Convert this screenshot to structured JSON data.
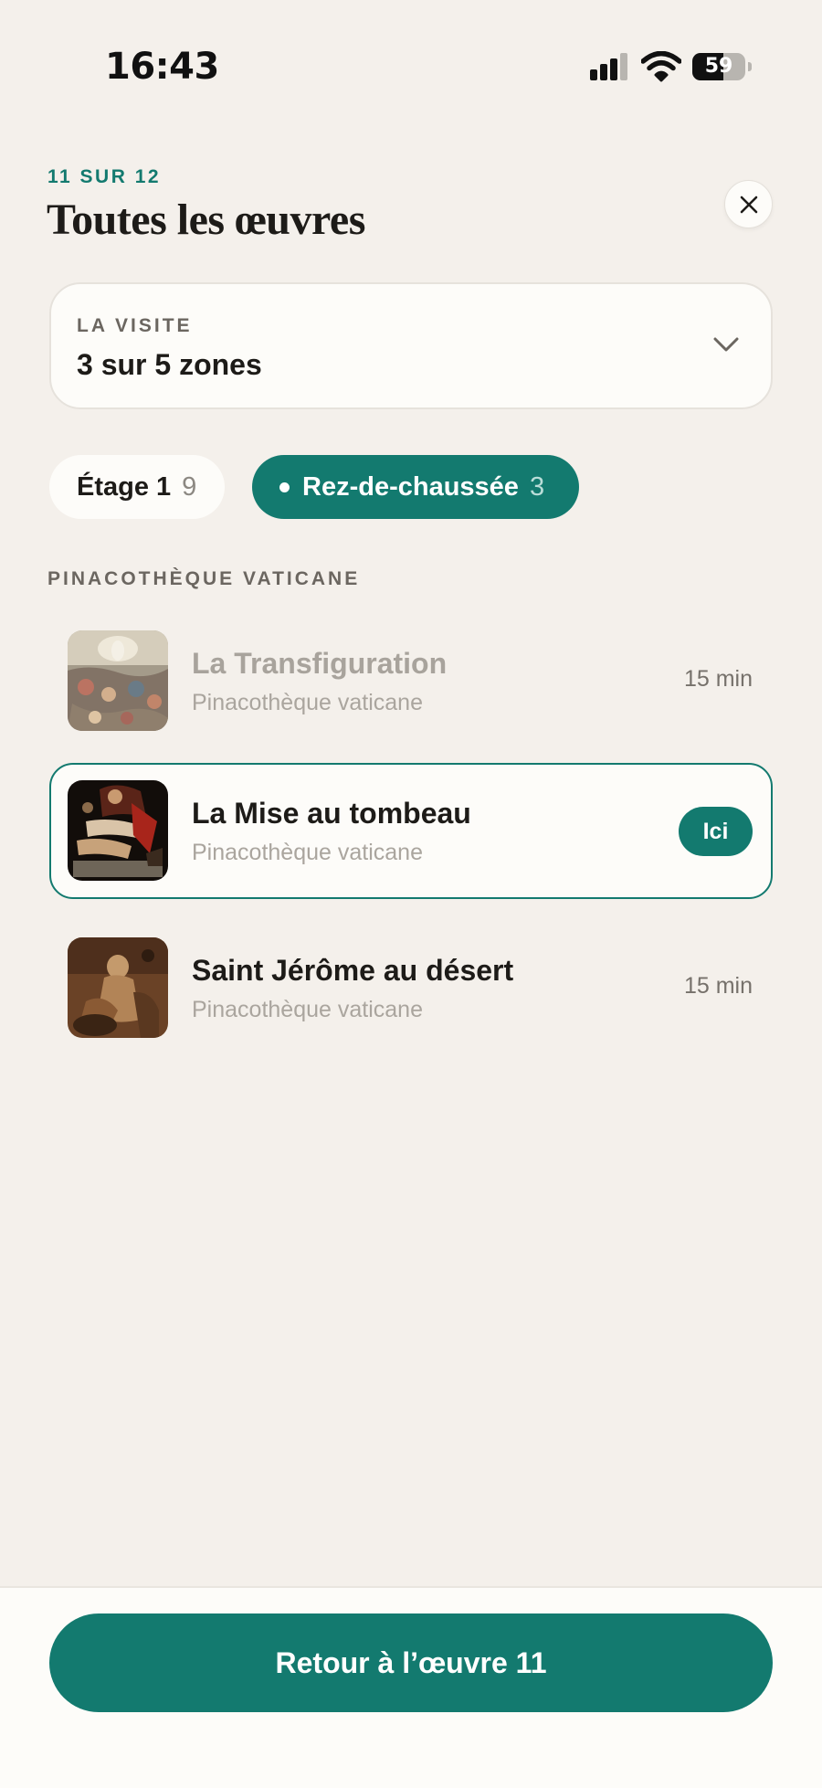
{
  "status_bar": {
    "time": "16:43",
    "battery": "59",
    "battery_level": 0.59,
    "icons": [
      "signal-icon",
      "wifi-icon",
      "battery-icon"
    ]
  },
  "header": {
    "counter": "11 SUR 12",
    "title": "Toutes les œuvres",
    "close_icon": "close-icon"
  },
  "visit": {
    "label": "LA VISITE",
    "value": "3 sur 5 zones",
    "icon": "chevron-down-icon"
  },
  "floors": [
    {
      "label": "Étage 1",
      "count": "9",
      "selected": false
    },
    {
      "label": "Rez-de-chaussée",
      "count": "3",
      "selected": true
    }
  ],
  "section": {
    "title": "PINACOTHÈQUE VATICANE"
  },
  "artworks": [
    {
      "title": "La Transfiguration",
      "location": "Pinacothèque vaticane",
      "duration": "15 min",
      "state": "visited"
    },
    {
      "title": "La Mise au tombeau",
      "location": "Pinacothèque vaticane",
      "badge": "Ici",
      "state": "current"
    },
    {
      "title": "Saint Jérôme au désert",
      "location": "Pinacothèque vaticane",
      "duration": "15 min",
      "state": "upcoming"
    }
  ],
  "footer": {
    "back_label": "Retour à l’œuvre 11"
  },
  "colors": {
    "accent": "#137a6f",
    "background": "#f4f0eb",
    "surface": "#fdfcf9"
  }
}
